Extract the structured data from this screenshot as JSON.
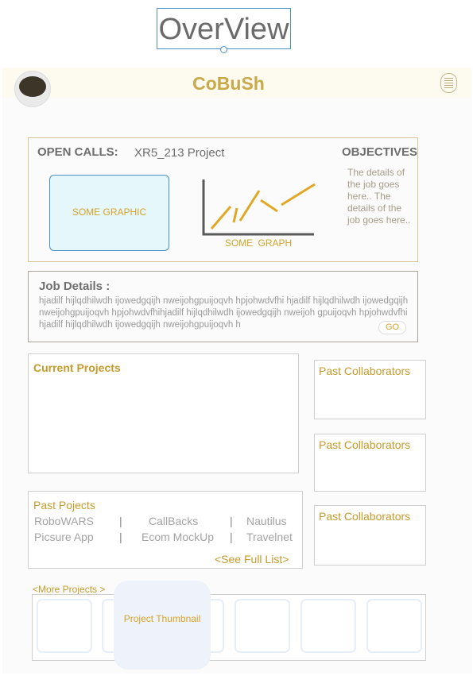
{
  "overview": {
    "label": "OverView"
  },
  "app": {
    "title": "CoBuSh"
  },
  "open_calls": {
    "label": "OPEN CALLS:",
    "project": "XR5_213 Project",
    "objectives_label": "OBJECTIVES",
    "objectives_text": "The details of the job goes here..    The details of the job goes here..",
    "graphic_label": "SOME GRAPHIC",
    "graph_label": "SOME  GRAPH",
    "graph_color": "#e0a925"
  },
  "job_details": {
    "label": "Job Details :",
    "text": "hjadilf hijlqdhilwdh ijowedgqijh nweijohgpuijoqvh hpjohwdvfhi hjadilf hijlqdhilwdh ijowedgqijh nweijohgpuijoqvh hpjohwdvfhihjadilf hijlqdhilwdh ijowedgqijh nweijoh gpuijoqvh hpjohwdvfhihjadilf hijlqdhilwdh ijowedgqijh nweijohgpuijoqvh h",
    "go_label": "GO"
  },
  "current_projects": {
    "label": "Current Projects"
  },
  "past_collaborators": [
    {
      "label": "Past Collaborators"
    },
    {
      "label": "Past Collaborators"
    },
    {
      "label": "Past Collaborators"
    }
  ],
  "past_projects": {
    "label": "Past Pojects",
    "rows": [
      [
        "RoboWARS",
        "CallBacks",
        "Nautilus"
      ],
      [
        "Picsure App",
        "Ecom MockUp",
        "Travelnet"
      ]
    ],
    "separator": "|",
    "see_full_list": "<See Full List>"
  },
  "more_projects": {
    "label": "<More Projects >",
    "thumbnail_label": "Project Thumbnail"
  },
  "colors": {
    "accent": "#c59b2b",
    "header_bg": "#fdfaf0",
    "selection_blue": "#4a90c9"
  }
}
